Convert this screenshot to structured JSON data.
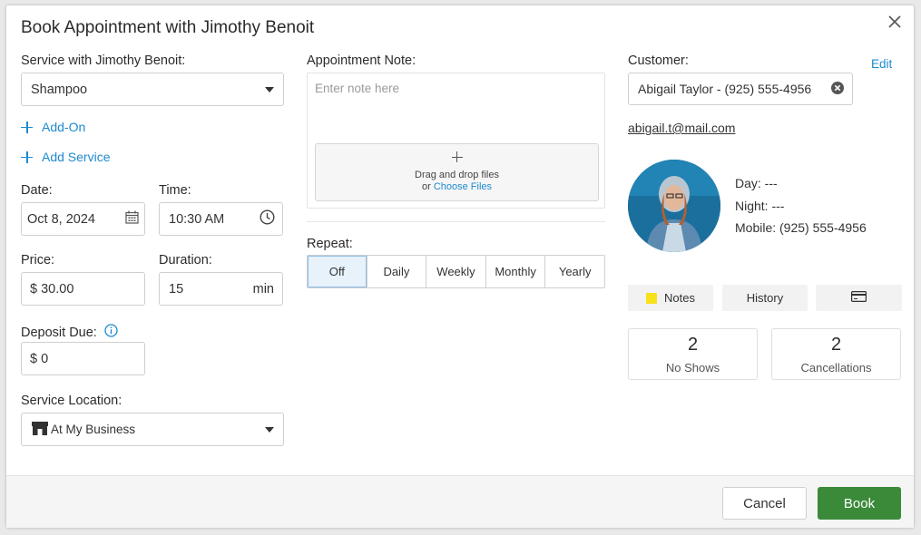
{
  "dialog": {
    "title": "Book Appointment with Jimothy Benoit"
  },
  "service": {
    "label": "Service with Jimothy Benoit:",
    "value": "Shampoo",
    "add_on_label": "Add-On",
    "add_service_label": "Add Service"
  },
  "date": {
    "label": "Date:",
    "value": "Oct 8, 2024"
  },
  "time": {
    "label": "Time:",
    "value": "10:30 AM"
  },
  "price": {
    "label": "Price:",
    "value": "$ 30.00"
  },
  "duration": {
    "label": "Duration:",
    "value": "15",
    "unit": "min"
  },
  "deposit": {
    "label": "Deposit Due:",
    "value": "$ 0"
  },
  "location": {
    "label": "Service Location:",
    "value": "At My Business"
  },
  "note": {
    "label": "Appointment Note:",
    "placeholder": "Enter note here",
    "drop_text": "Drag and drop files",
    "or_text": "or",
    "choose_files": "Choose Files"
  },
  "repeat": {
    "label": "Repeat:",
    "options": [
      "Off",
      "Daily",
      "Weekly",
      "Monthly",
      "Yearly"
    ],
    "selected": "Off"
  },
  "customer": {
    "label": "Customer:",
    "edit_label": "Edit",
    "value": "Abigail Taylor - (925) 555-4956",
    "email": "abigail.t@mail.com",
    "day": "Day: ---",
    "night": "Night: ---",
    "mobile": "Mobile: (925) 555-4956",
    "tabs": {
      "notes": "Notes",
      "history": "History"
    },
    "no_shows": {
      "count": "2",
      "label": "No Shows"
    },
    "cancellations": {
      "count": "2",
      "label": "Cancellations"
    }
  },
  "footer": {
    "cancel_label": "Cancel",
    "book_label": "Book"
  },
  "colors": {
    "accent": "#1d8ad0",
    "book_button": "#3a8a3a",
    "notes_icon": "#f7e21a",
    "selected_segment": "#e7f2fb"
  },
  "icons": [
    "close-icon",
    "chevron-down-icon",
    "plus-icon",
    "calendar-icon",
    "clock-icon",
    "info-icon",
    "store-icon",
    "clear-icon",
    "sticky-note-icon",
    "credit-card-icon"
  ]
}
